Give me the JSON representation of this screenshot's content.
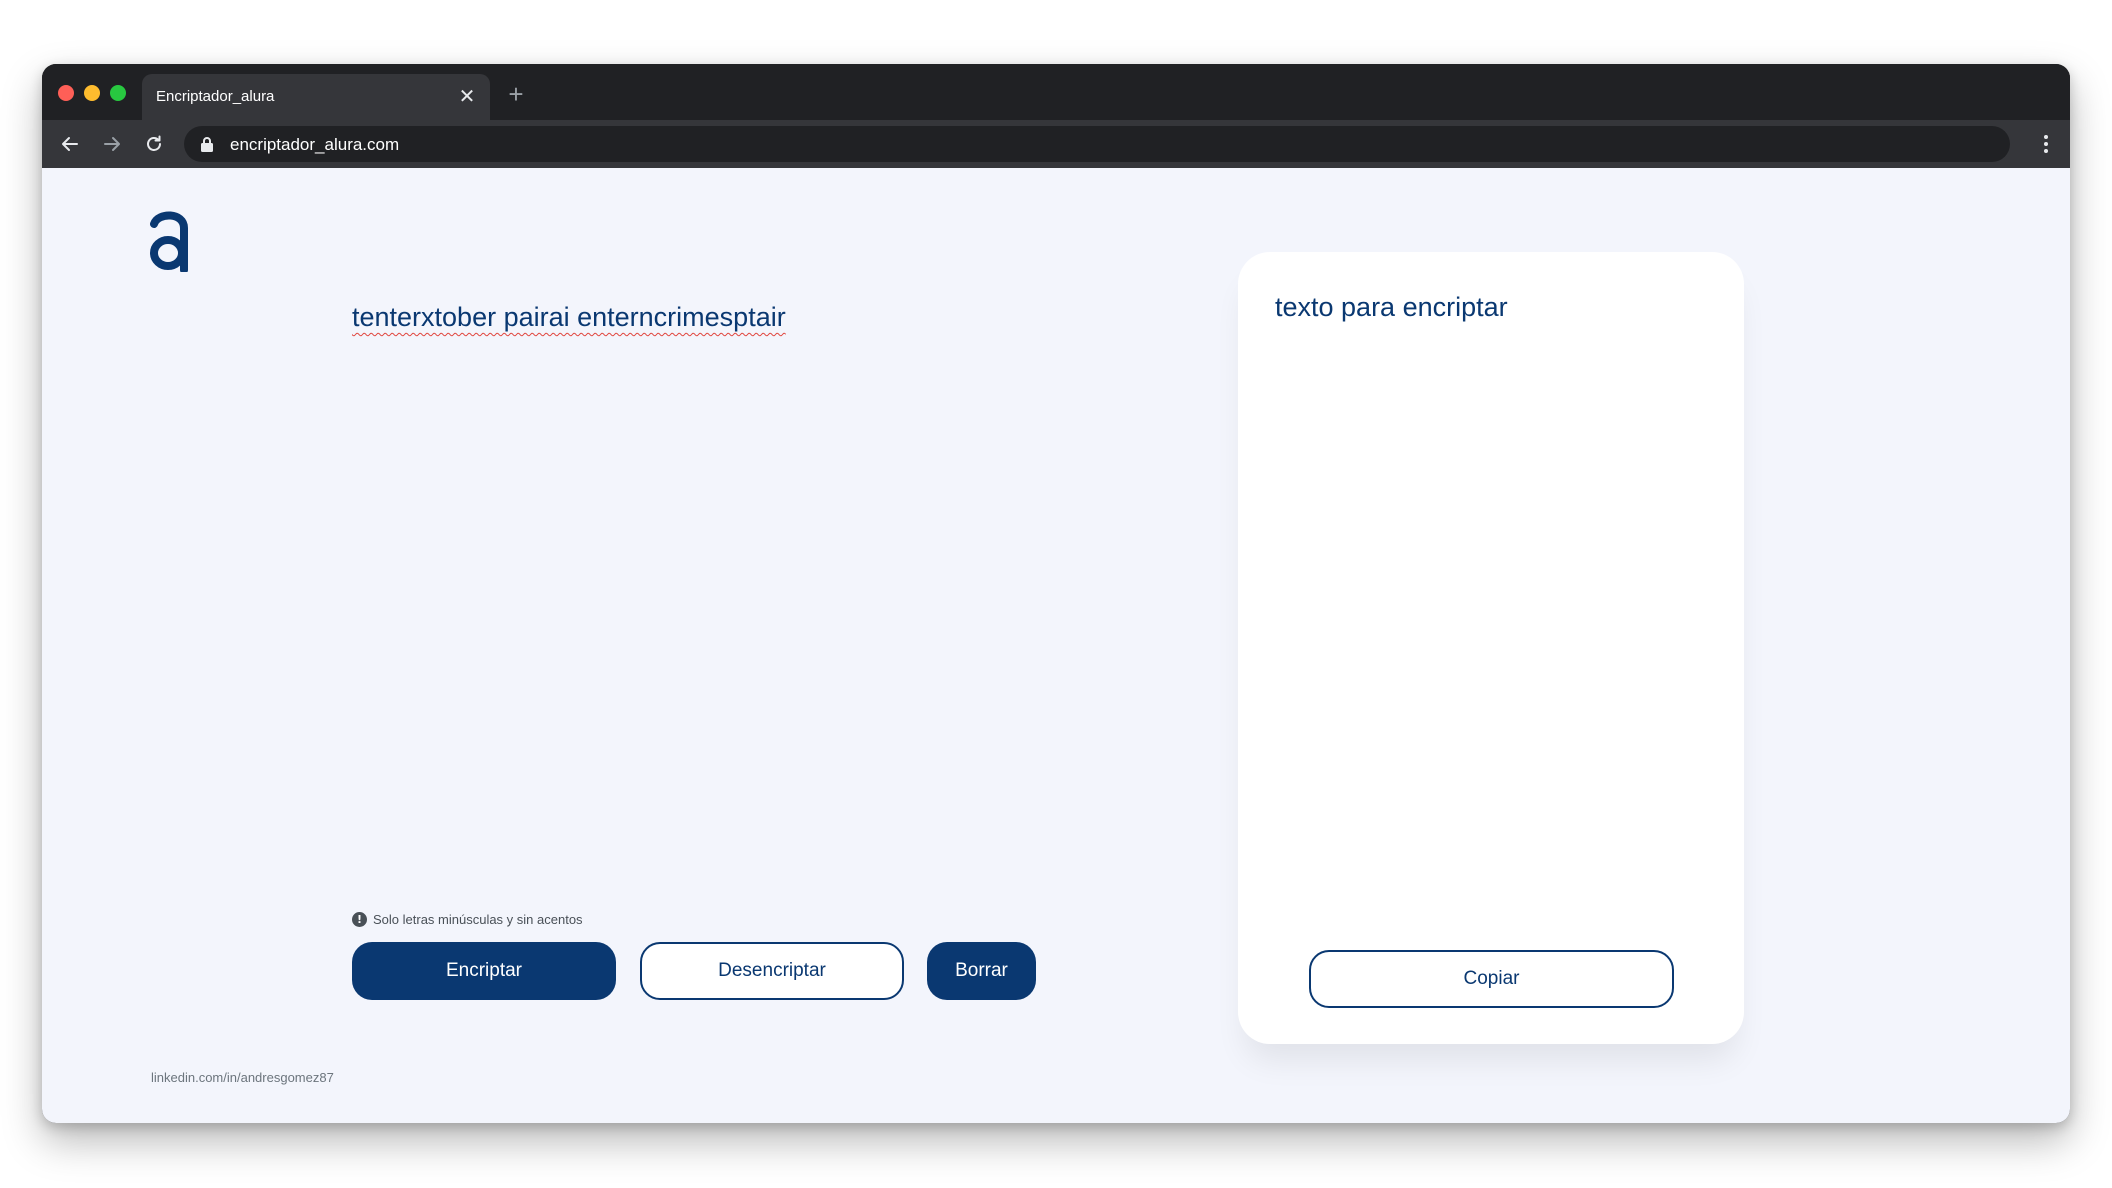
{
  "browser": {
    "tab_title": "Encriptador_alura",
    "url": "encriptador_alura.com",
    "icons": {
      "close": "close-icon",
      "new_tab": "plus-icon",
      "back": "arrow-left-icon",
      "forward": "arrow-right-icon",
      "reload": "reload-icon",
      "lock": "lock-icon",
      "menu": "kebab-menu-icon"
    }
  },
  "page": {
    "logo_icon": "alura-logo-icon",
    "input_text": "tenterxtober pairai enterncrimesptair",
    "hint": {
      "icon": "info-icon",
      "text": "Solo letras minúsculas y sin acentos"
    },
    "buttons": {
      "encrypt": "Encriptar",
      "decrypt": "Desencriptar",
      "clear": "Borrar"
    },
    "output": {
      "text": "texto para encriptar",
      "copy_label": "Copiar"
    },
    "footer_link": "linkedin.com/in/andresgomez87"
  },
  "colors": {
    "brand": "#0a3871",
    "background": "#f3f5fc",
    "card": "#ffffff",
    "hint": "#495057"
  }
}
